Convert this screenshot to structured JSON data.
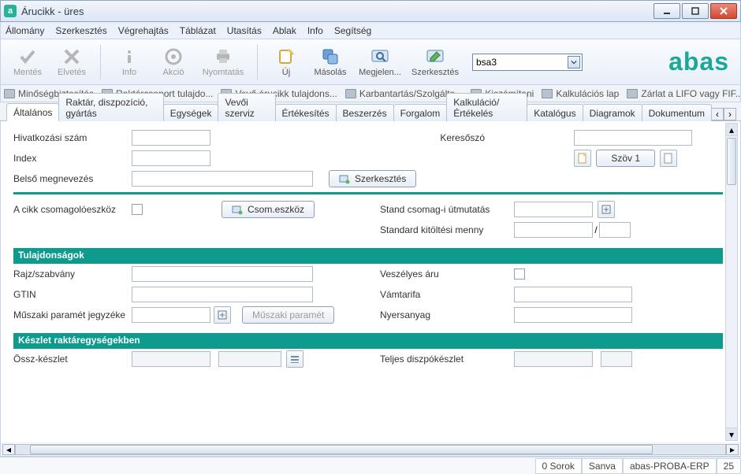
{
  "window": {
    "title": "Árucikk - üres"
  },
  "menu": [
    "Állomány",
    "Szerkesztés",
    "Végrehajtás",
    "Táblázat",
    "Utasítás",
    "Ablak",
    "Info",
    "Segítség"
  ],
  "toolbar": {
    "save": "Mentés",
    "discard": "Elvetés",
    "info": "Info",
    "action": "Akció",
    "print": "Nyomtatás",
    "new": "Új",
    "copy": "Másolás",
    "show": "Megjelen...",
    "edit": "Szerkesztés",
    "combo_value": "bsa3"
  },
  "brand": "abas",
  "linkbar": [
    "Minőségbiztosítás",
    "Raktárcsoport tulajdo...",
    "Vevő árucikk tulajdons...",
    "Karbantartás/Szolgálta...",
    "Kiszámítani",
    "Kalkulációs lap",
    "Zárlat a LIFO vagy FIF..."
  ],
  "tabs": [
    "Általános",
    "Raktár, diszpozíció, gyártás",
    "Egységek",
    "Vevői szerviz",
    "Értékesítés",
    "Beszerzés",
    "Forgalom",
    "Kalkuláció/Értékelés",
    "Katalógus",
    "Diagramok",
    "Dokumentum"
  ],
  "form": {
    "ref_label": "Hivatkozási szám",
    "search_label": "Keresőszó",
    "index_label": "Index",
    "szov_btn": "Szöv 1",
    "inner_name_label": "Belső megnevezés",
    "edit_btn": "Szerkesztés",
    "pack_tool_label": "A cikk csomagolóeszköz",
    "pack_btn": "Csom.eszköz",
    "stand_pack_label": "Stand csomag-i útmutatás",
    "std_fill_label": "Standard kitöltési menny",
    "slash": "/",
    "section_props": "Tulajdonságok",
    "draw_std_label": "Rajz/szabvány",
    "gtin_label": "GTIN",
    "tech_param_label": "Műszaki paramét jegyzéke",
    "tech_param_btn": "Műszaki paramét",
    "hazard_label": "Veszélyes áru",
    "tariff_label": "Vámtarifa",
    "raw_label": "Nyersanyag",
    "section_stock": "Készlet raktáregységekben",
    "total_stock_label": "Össz-készlet",
    "total_dispo_label": "Teljes diszpókészlet"
  },
  "status": {
    "rows": "0 Sorok",
    "user": "Sanva",
    "db": "abas-PROBA-ERP",
    "num": "25"
  }
}
